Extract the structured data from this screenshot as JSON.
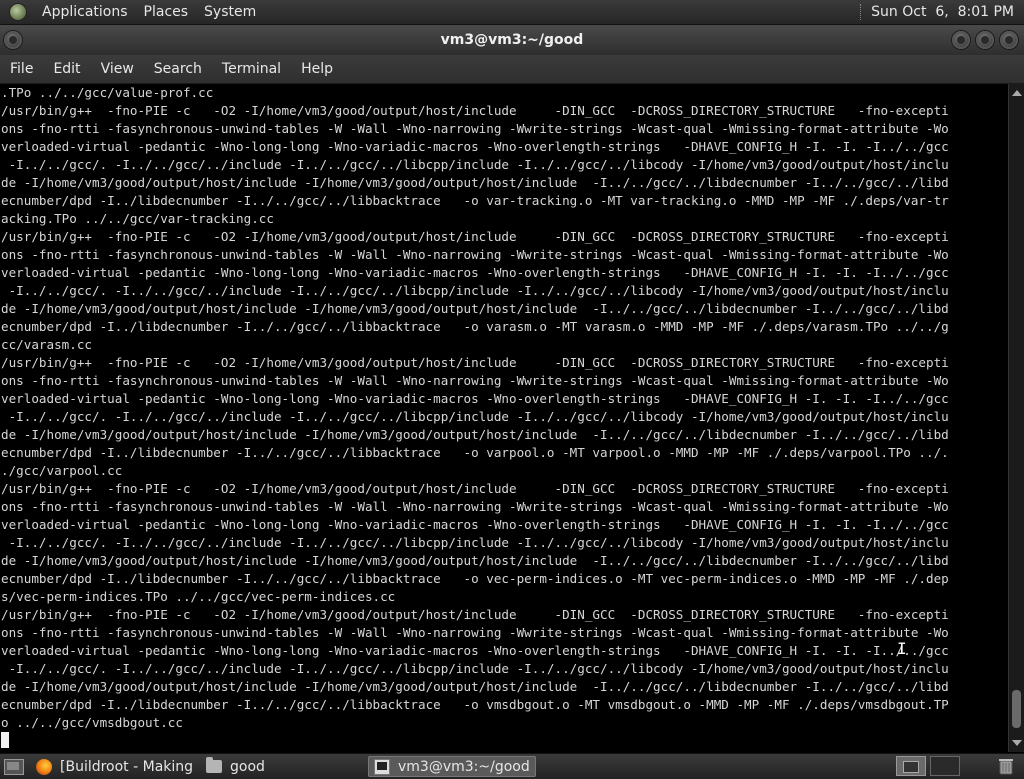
{
  "top_panel": {
    "menus": [
      "Applications",
      "Places",
      "System"
    ],
    "clock": "Sun Oct  6,  8:01 PM"
  },
  "window": {
    "title": "vm3@vm3:~/good"
  },
  "menubar": {
    "items": [
      "File",
      "Edit",
      "View",
      "Search",
      "Terminal",
      "Help"
    ]
  },
  "terminal": {
    "lines": [
      ".TPo ../../gcc/value-prof.cc",
      "/usr/bin/g++  -fno-PIE -c   -O2 -I/home/vm3/good/output/host/include     -DIN_GCC  -DCROSS_DIRECTORY_STRUCTURE   -fno-excepti",
      "ons -fno-rtti -fasynchronous-unwind-tables -W -Wall -Wno-narrowing -Wwrite-strings -Wcast-qual -Wmissing-format-attribute -Wo",
      "verloaded-virtual -pedantic -Wno-long-long -Wno-variadic-macros -Wno-overlength-strings   -DHAVE_CONFIG_H -I. -I. -I../../gcc",
      " -I../../gcc/. -I../../gcc/../include -I../../gcc/../libcpp/include -I../../gcc/../libcody -I/home/vm3/good/output/host/inclu",
      "de -I/home/vm3/good/output/host/include -I/home/vm3/good/output/host/include  -I../../gcc/../libdecnumber -I../../gcc/../libd",
      "ecnumber/dpd -I../libdecnumber -I../../gcc/../libbacktrace   -o var-tracking.o -MT var-tracking.o -MMD -MP -MF ./.deps/var-tr",
      "acking.TPo ../../gcc/var-tracking.cc",
      "/usr/bin/g++  -fno-PIE -c   -O2 -I/home/vm3/good/output/host/include     -DIN_GCC  -DCROSS_DIRECTORY_STRUCTURE   -fno-excepti",
      "ons -fno-rtti -fasynchronous-unwind-tables -W -Wall -Wno-narrowing -Wwrite-strings -Wcast-qual -Wmissing-format-attribute -Wo",
      "verloaded-virtual -pedantic -Wno-long-long -Wno-variadic-macros -Wno-overlength-strings   -DHAVE_CONFIG_H -I. -I. -I../../gcc",
      " -I../../gcc/. -I../../gcc/../include -I../../gcc/../libcpp/include -I../../gcc/../libcody -I/home/vm3/good/output/host/inclu",
      "de -I/home/vm3/good/output/host/include -I/home/vm3/good/output/host/include  -I../../gcc/../libdecnumber -I../../gcc/../libd",
      "ecnumber/dpd -I../libdecnumber -I../../gcc/../libbacktrace   -o varasm.o -MT varasm.o -MMD -MP -MF ./.deps/varasm.TPo ../../g",
      "cc/varasm.cc",
      "/usr/bin/g++  -fno-PIE -c   -O2 -I/home/vm3/good/output/host/include     -DIN_GCC  -DCROSS_DIRECTORY_STRUCTURE   -fno-excepti",
      "ons -fno-rtti -fasynchronous-unwind-tables -W -Wall -Wno-narrowing -Wwrite-strings -Wcast-qual -Wmissing-format-attribute -Wo",
      "verloaded-virtual -pedantic -Wno-long-long -Wno-variadic-macros -Wno-overlength-strings   -DHAVE_CONFIG_H -I. -I. -I../../gcc",
      " -I../../gcc/. -I../../gcc/../include -I../../gcc/../libcpp/include -I../../gcc/../libcody -I/home/vm3/good/output/host/inclu",
      "de -I/home/vm3/good/output/host/include -I/home/vm3/good/output/host/include  -I../../gcc/../libdecnumber -I../../gcc/../libd",
      "ecnumber/dpd -I../libdecnumber -I../../gcc/../libbacktrace   -o varpool.o -MT varpool.o -MMD -MP -MF ./.deps/varpool.TPo ../.",
      "./gcc/varpool.cc",
      "/usr/bin/g++  -fno-PIE -c   -O2 -I/home/vm3/good/output/host/include     -DIN_GCC  -DCROSS_DIRECTORY_STRUCTURE   -fno-excepti",
      "ons -fno-rtti -fasynchronous-unwind-tables -W -Wall -Wno-narrowing -Wwrite-strings -Wcast-qual -Wmissing-format-attribute -Wo",
      "verloaded-virtual -pedantic -Wno-long-long -Wno-variadic-macros -Wno-overlength-strings   -DHAVE_CONFIG_H -I. -I. -I../../gcc",
      " -I../../gcc/. -I../../gcc/../include -I../../gcc/../libcpp/include -I../../gcc/../libcody -I/home/vm3/good/output/host/inclu",
      "de -I/home/vm3/good/output/host/include -I/home/vm3/good/output/host/include  -I../../gcc/../libdecnumber -I../../gcc/../libd",
      "ecnumber/dpd -I../libdecnumber -I../../gcc/../libbacktrace   -o vec-perm-indices.o -MT vec-perm-indices.o -MMD -MP -MF ./.dep",
      "s/vec-perm-indices.TPo ../../gcc/vec-perm-indices.cc",
      "/usr/bin/g++  -fno-PIE -c   -O2 -I/home/vm3/good/output/host/include     -DIN_GCC  -DCROSS_DIRECTORY_STRUCTURE   -fno-excepti",
      "ons -fno-rtti -fasynchronous-unwind-tables -W -Wall -Wno-narrowing -Wwrite-strings -Wcast-qual -Wmissing-format-attribute -Wo",
      "verloaded-virtual -pedantic -Wno-long-long -Wno-variadic-macros -Wno-overlength-strings   -DHAVE_CONFIG_H -I. -I. -I../../gcc",
      " -I../../gcc/. -I../../gcc/../include -I../../gcc/../libcpp/include -I../../gcc/../libcody -I/home/vm3/good/output/host/inclu",
      "de -I/home/vm3/good/output/host/include -I/home/vm3/good/output/host/include  -I../../gcc/../libdecnumber -I../../gcc/../libd",
      "ecnumber/dpd -I../libdecnumber -I../../gcc/../libbacktrace   -o vmsdbgout.o -MT vmsdbgout.o -MMD -MP -MF ./.deps/vmsdbgout.TP",
      "o ../../gcc/vmsdbgout.cc"
    ]
  },
  "taskbar": {
    "tasks": [
      {
        "label": "[Buildroot - Making ...",
        "icon": "firefox-icon"
      },
      {
        "label": "good",
        "icon": "folder-icon"
      },
      {
        "label": "vm3@vm3:~/good",
        "icon": "terminal-icon"
      }
    ]
  }
}
